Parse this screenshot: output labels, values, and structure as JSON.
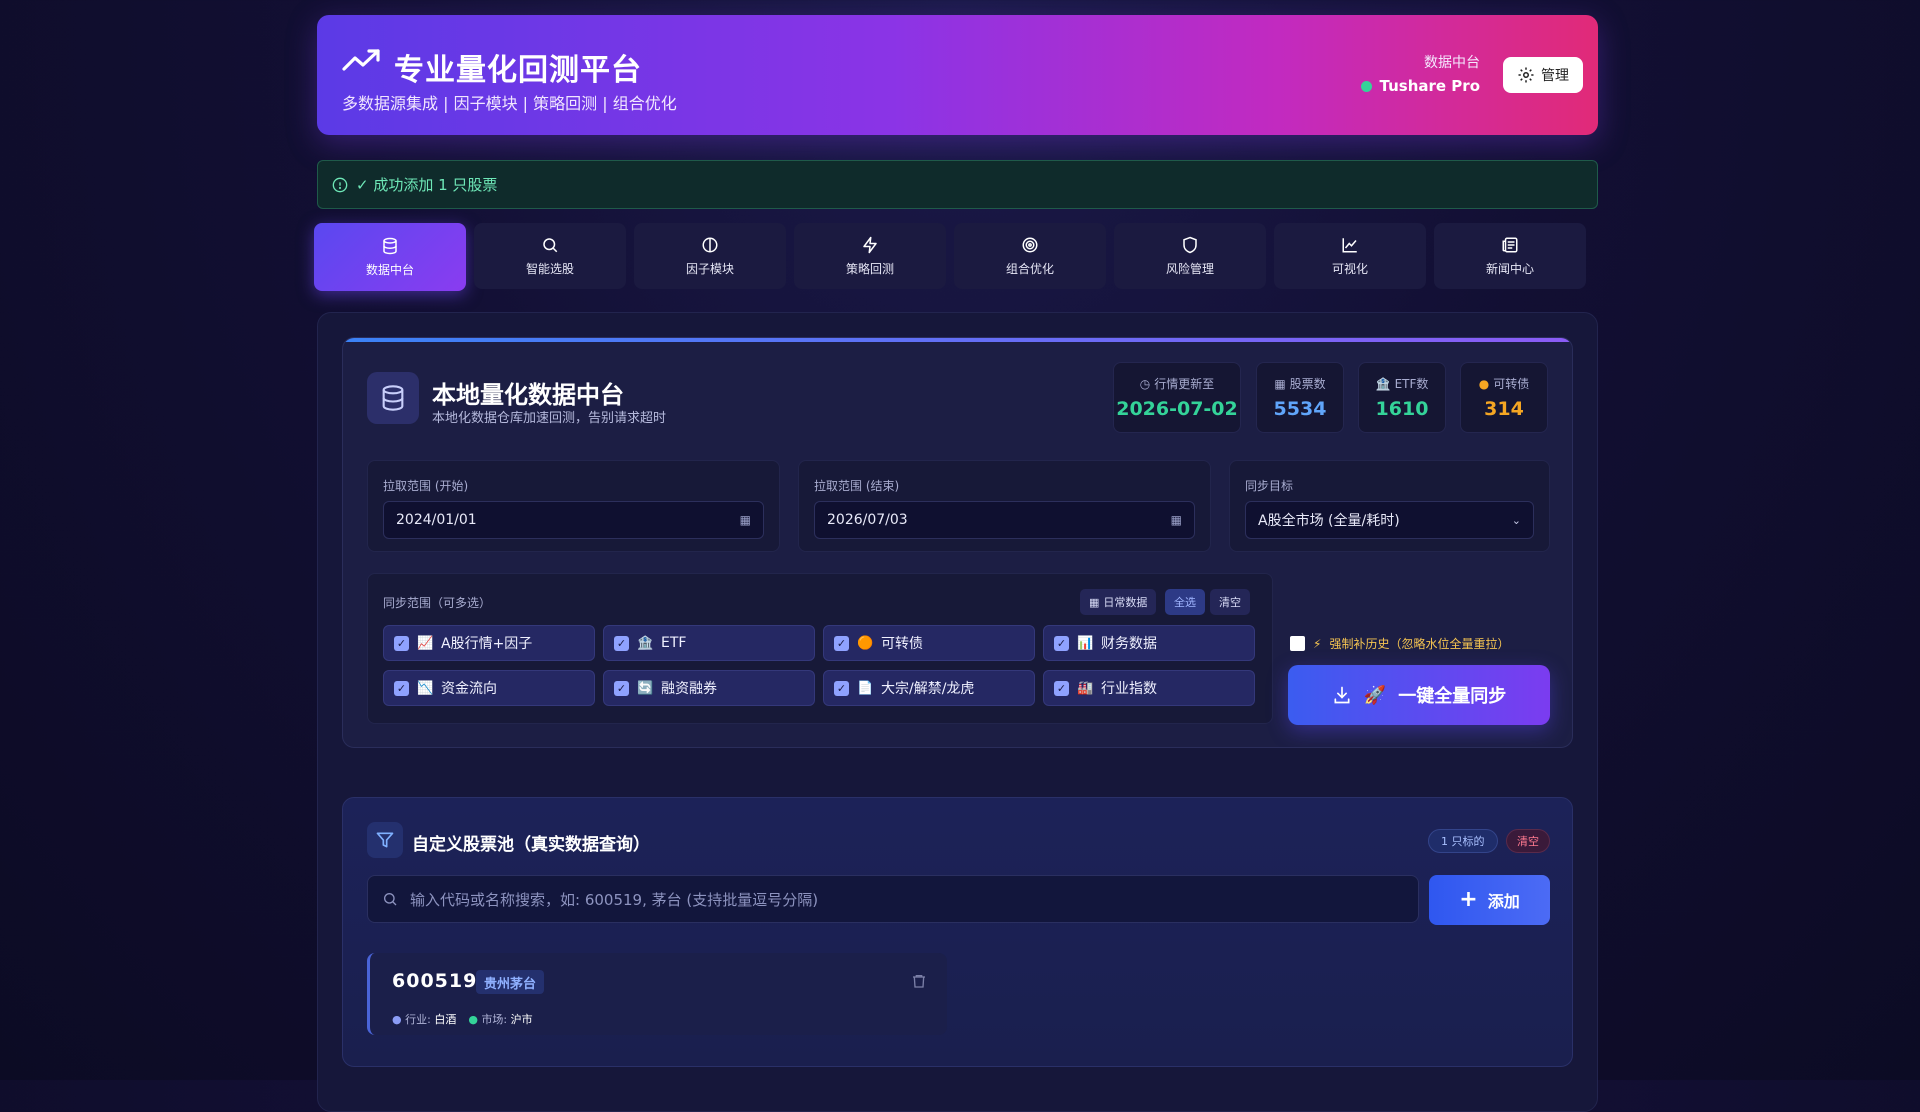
{
  "header": {
    "title": "专业量化回测平台",
    "subtitle": "多数据源集成 | 因子模块 | 策略回测 | 组合优化",
    "source_label": "数据中台",
    "source_name": "Tushare Pro",
    "manage_label": "管理"
  },
  "alert": {
    "message": "✓ 成功添加 1 只股票"
  },
  "tabs": [
    {
      "label": "数据中台",
      "icon": "database-icon",
      "active": true
    },
    {
      "label": "智能选股",
      "icon": "search-icon"
    },
    {
      "label": "因子模块",
      "icon": "contrast-icon"
    },
    {
      "label": "策略回测",
      "icon": "bolt-icon"
    },
    {
      "label": "组合优化",
      "icon": "target-icon"
    },
    {
      "label": "风险管理",
      "icon": "shield-icon"
    },
    {
      "label": "可视化",
      "icon": "line-chart-icon"
    },
    {
      "label": "新闻中心",
      "icon": "newspaper-icon"
    }
  ],
  "data_center": {
    "title": "本地量化数据中台",
    "subtitle": "本地化数据仓库加速回测，告别请求超时",
    "stats": [
      {
        "label": "行情更新至",
        "value": "2026-07-02",
        "color": "#34d399",
        "icon": "clock-icon"
      },
      {
        "label": "股票数",
        "value": "5534",
        "color": "#60a5fa",
        "icon": "chart-square-icon"
      },
      {
        "label": "ETF数",
        "value": "1610",
        "color": "#34d399",
        "icon": "bank-icon"
      },
      {
        "label": "可转债",
        "value": "314",
        "color": "#f5a623",
        "icon": "coin-icon"
      }
    ],
    "range_start": {
      "label": "拉取范围 (开始)",
      "value": "2024/01/01"
    },
    "range_end": {
      "label": "拉取范围 (结束)",
      "value": "2026/07/03"
    },
    "sync_target": {
      "label": "同步目标",
      "value": "A股全市场 (全量/耗时)"
    },
    "scope": {
      "label": "同步范围（可多选）",
      "daily_label": "日常数据",
      "select_all_label": "全选",
      "clear_label": "清空",
      "items": [
        {
          "label": "A股行情+因子",
          "icon": "📈"
        },
        {
          "label": "ETF",
          "icon": "🏦"
        },
        {
          "label": "可转债",
          "icon": "🟠"
        },
        {
          "label": "财务数据",
          "icon": "📊"
        },
        {
          "label": "资金流向",
          "icon": "📉"
        },
        {
          "label": "融资融券",
          "icon": "🔄"
        },
        {
          "label": "大宗/解禁/龙虎",
          "icon": "📄"
        },
        {
          "label": "行业指数",
          "icon": "🏭"
        }
      ]
    },
    "force_label": "强制补历史（忽略水位全量重拉）",
    "sync_button": "一键全量同步"
  },
  "pool": {
    "title": "自定义股票池（真实数据查询）",
    "count_label": "1 只标的",
    "clear_label": "清空",
    "search_placeholder": "输入代码或名称搜索，如: 600519, 茅台 (支持批量逗号分隔)",
    "add_label": "添加",
    "stocks": [
      {
        "code": "600519",
        "name": "贵州茅台",
        "industry_label": "行业:",
        "industry": "白酒",
        "market_label": "市场:",
        "market": "沪市"
      }
    ]
  }
}
